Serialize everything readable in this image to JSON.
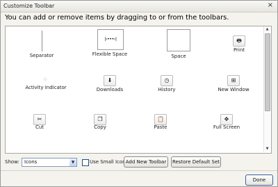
{
  "window": {
    "title": "Customize Toolbar",
    "close_icon": "×"
  },
  "instructions": "You can add or remove items by dragging to or from the toolbars.",
  "palette": {
    "items": [
      {
        "label": "Separator",
        "kind": "separator",
        "icon": "separator-icon"
      },
      {
        "label": "Flexible Space",
        "kind": "flexible-space",
        "icon": "flexible-space-icon",
        "glyph": "|‹•••›|"
      },
      {
        "label": "Space",
        "kind": "space",
        "icon": "space-icon"
      },
      {
        "label": "Print",
        "kind": "button",
        "icon": "printer-icon",
        "glyph": "🖶"
      },
      {
        "label": "Activity Indicator",
        "kind": "activity",
        "icon": "activity-throbber-icon",
        "glyph": "⁘"
      },
      {
        "label": "Downloads",
        "kind": "button",
        "icon": "download-arrow-icon",
        "glyph": "⬇"
      },
      {
        "label": "History",
        "kind": "button",
        "icon": "clock-icon",
        "glyph": "◷"
      },
      {
        "label": "New Window",
        "kind": "button",
        "icon": "new-window-icon",
        "glyph": "⊞"
      },
      {
        "label": "Cut",
        "kind": "button",
        "icon": "scissors-icon",
        "glyph": "✂"
      },
      {
        "label": "Copy",
        "kind": "button",
        "icon": "copy-icon",
        "glyph": "❐"
      },
      {
        "label": "Paste",
        "kind": "button",
        "icon": "clipboard-icon",
        "glyph": "📋"
      },
      {
        "label": "Full Screen",
        "kind": "button",
        "icon": "full-screen-icon",
        "glyph": "✥"
      }
    ]
  },
  "scroll_up_icon": "▲",
  "scroll_down_icon": "▼",
  "bottom": {
    "show_label": "Show:",
    "show_value": "Icons",
    "dropdown_icon": "▼",
    "small_icons_label": "Use Small Icons",
    "small_icons_checked": false,
    "add_toolbar_label": "Add New Toolbar",
    "restore_label": "Restore Default Set"
  },
  "done_label": "Done"
}
